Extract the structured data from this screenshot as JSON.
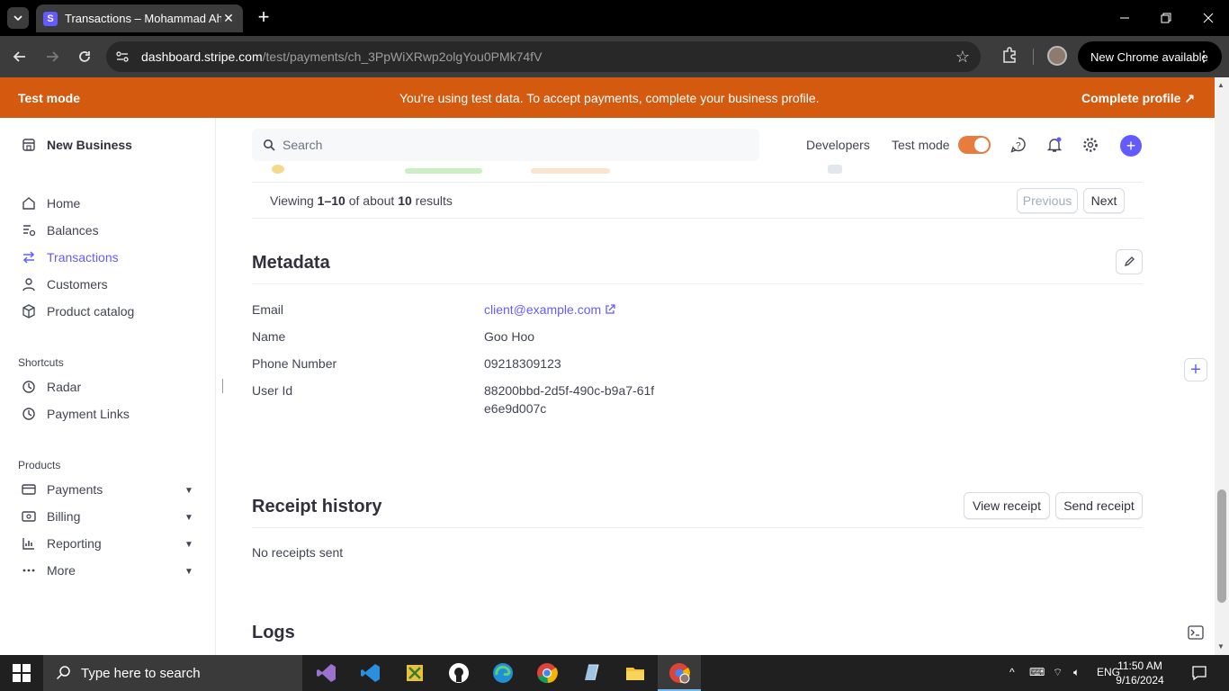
{
  "browser": {
    "tab_title": "Transactions – Mohammad Ahmadi",
    "url_host": "dashboard.stripe.com",
    "url_path": "/test/payments/ch_3PpWiXRwp2olgYou0PMk74fV",
    "update_label": "New Chrome available"
  },
  "banner": {
    "left": "Test mode",
    "center": "You're using test data. To accept payments, complete your business profile.",
    "right": "Complete profile ↗"
  },
  "sidebar": {
    "business": "New Business",
    "items": [
      {
        "label": "Home",
        "icon": "home-icon"
      },
      {
        "label": "Balances",
        "icon": "balances-icon"
      },
      {
        "label": "Transactions",
        "icon": "transactions-icon",
        "active": true
      },
      {
        "label": "Customers",
        "icon": "customers-icon"
      },
      {
        "label": "Product catalog",
        "icon": "product-catalog-icon"
      }
    ],
    "shortcuts_heading": "Shortcuts",
    "shortcuts": [
      {
        "label": "Radar",
        "icon": "clock-icon"
      },
      {
        "label": "Payment Links",
        "icon": "clock-icon"
      }
    ],
    "products_heading": "Products",
    "products": [
      {
        "label": "Payments",
        "icon": "payments-icon"
      },
      {
        "label": "Billing",
        "icon": "billing-icon"
      },
      {
        "label": "Reporting",
        "icon": "reporting-icon"
      },
      {
        "label": "More",
        "icon": "more-icon"
      }
    ]
  },
  "topbar": {
    "search_placeholder": "Search",
    "developers": "Developers",
    "test_mode": "Test mode"
  },
  "pagination": {
    "prefix": "Viewing ",
    "range": "1–10",
    "middle": " of about ",
    "total": "10",
    "suffix": " results",
    "previous": "Previous",
    "next": "Next"
  },
  "metadata": {
    "title": "Metadata",
    "rows": [
      {
        "label": "Email",
        "value": "client@example.com"
      },
      {
        "label": "Name",
        "value": "Goo Hoo"
      },
      {
        "label": "Phone Number",
        "value": "09218309123"
      },
      {
        "label": "User Id",
        "value": "88200bbd-2d5f-490c-b9a7-61fe6e9d007c"
      }
    ]
  },
  "receipts": {
    "title": "Receipt history",
    "view": "View receipt",
    "send": "Send receipt",
    "empty": "No receipts sent"
  },
  "logs": {
    "title": "Logs"
  },
  "taskbar": {
    "search_placeholder": "Type here to search",
    "lang": "ENG",
    "time": "11:50 AM",
    "date": "9/16/2024"
  },
  "colors": {
    "accent": "#635bff",
    "test_banner": "#d45a0f"
  }
}
